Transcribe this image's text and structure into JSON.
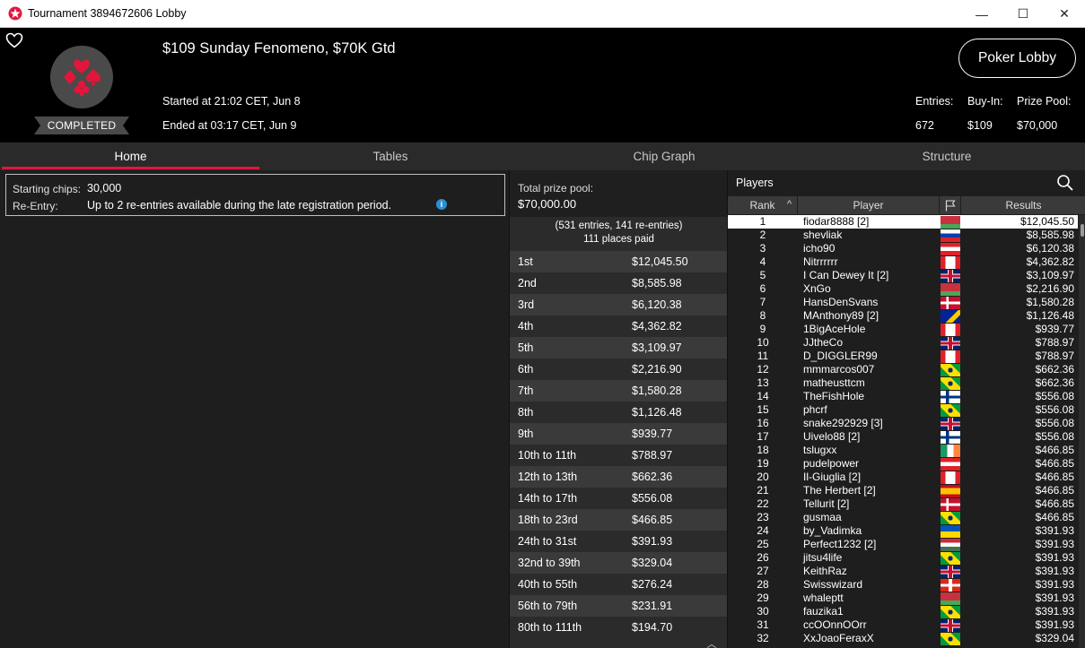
{
  "window": {
    "title": "Tournament 3894672606 Lobby",
    "minimize_glyph": "—",
    "maximize_glyph": "☐",
    "close_glyph": "✕"
  },
  "header": {
    "tournament_name": "$109 Sunday Fenomeno, $70K Gtd",
    "status": "COMPLETED",
    "started": "Started at 21:02 CET, Jun 8",
    "ended": "Ended at 03:17 CET, Jun 9",
    "poker_lobby_label": "Poker Lobby",
    "entries_label": "Entries:",
    "entries_value": "672",
    "buyin_label": "Buy-In:",
    "buyin_value": "$109",
    "prizepool_label": "Prize Pool:",
    "prizepool_value": "$70,000"
  },
  "tabs": [
    {
      "label": "Home"
    },
    {
      "label": "Tables"
    },
    {
      "label": "Chip Graph"
    },
    {
      "label": "Structure"
    }
  ],
  "home": {
    "starting_chips_label": "Starting chips:",
    "starting_chips_value": "30,000",
    "reentry_label": "Re-Entry:",
    "reentry_value": "Up to 2 re-entries available during the late registration period.",
    "info_glyph": "i"
  },
  "prizes": {
    "total_label": "Total prize pool:",
    "total_value": "$70,000.00",
    "entries_summary": "(531 entries, 141 re-entries)",
    "places_paid": "111 places paid",
    "scroll_up_glyph": "︿",
    "payouts": [
      {
        "place": "1st",
        "amount": "$12,045.50"
      },
      {
        "place": "2nd",
        "amount": "$8,585.98"
      },
      {
        "place": "3rd",
        "amount": "$6,120.38"
      },
      {
        "place": "4th",
        "amount": "$4,362.82"
      },
      {
        "place": "5th",
        "amount": "$3,109.97"
      },
      {
        "place": "6th",
        "amount": "$2,216.90"
      },
      {
        "place": "7th",
        "amount": "$1,580.28"
      },
      {
        "place": "8th",
        "amount": "$1,126.48"
      },
      {
        "place": "9th",
        "amount": "$939.77"
      },
      {
        "place": "10th to 11th",
        "amount": "$788.97"
      },
      {
        "place": "12th to 13th",
        "amount": "$662.36"
      },
      {
        "place": "14th to 17th",
        "amount": "$556.08"
      },
      {
        "place": "18th to 23rd",
        "amount": "$466.85"
      },
      {
        "place": "24th to 31st",
        "amount": "$391.93"
      },
      {
        "place": "32nd to 39th",
        "amount": "$329.04"
      },
      {
        "place": "40th to 55th",
        "amount": "$276.24"
      },
      {
        "place": "56th to 79th",
        "amount": "$231.91"
      },
      {
        "place": "80th to 111th",
        "amount": "$194.70"
      }
    ]
  },
  "players": {
    "title": "Players",
    "col_rank": "Rank",
    "col_player": "Player",
    "col_results": "Results",
    "sort_glyph": "^",
    "rows": [
      {
        "rank": "1",
        "name": "fiodar8888 [2]",
        "flag": "by",
        "result": "$12,045.50"
      },
      {
        "rank": "2",
        "name": "shevliak",
        "flag": "si",
        "result": "$8,585.98"
      },
      {
        "rank": "3",
        "name": "icho90",
        "flag": "at",
        "result": "$6,120.38"
      },
      {
        "rank": "4",
        "name": "Nitrrrrrr",
        "flag": "ca",
        "result": "$4,362.82"
      },
      {
        "rank": "5",
        "name": "I Can Dewey It [2]",
        "flag": "gb",
        "result": "$3,109.97"
      },
      {
        "rank": "6",
        "name": "XnGo",
        "flag": "by",
        "result": "$2,216.90"
      },
      {
        "rank": "7",
        "name": "HansDenSvans",
        "flag": "dk",
        "result": "$1,580.28"
      },
      {
        "rank": "8",
        "name": "MAnthony89 [2]",
        "flag": "ba",
        "result": "$1,126.48"
      },
      {
        "rank": "9",
        "name": "1BigAceHole",
        "flag": "ca",
        "result": "$939.77"
      },
      {
        "rank": "10",
        "name": "JJtheCo",
        "flag": "gb",
        "result": "$788.97"
      },
      {
        "rank": "11",
        "name": "D_DIGGLER99",
        "flag": "ca",
        "result": "$788.97"
      },
      {
        "rank": "12",
        "name": "mmmarcos007",
        "flag": "br",
        "result": "$662.36"
      },
      {
        "rank": "13",
        "name": "matheusttcm",
        "flag": "br",
        "result": "$662.36"
      },
      {
        "rank": "14",
        "name": "TheFishHole",
        "flag": "fi",
        "result": "$556.08"
      },
      {
        "rank": "15",
        "name": "phcrf",
        "flag": "br",
        "result": "$556.08"
      },
      {
        "rank": "16",
        "name": "snake292929 [3]",
        "flag": "gb",
        "result": "$556.08"
      },
      {
        "rank": "17",
        "name": "Uivelo88 [2]",
        "flag": "fi",
        "result": "$556.08"
      },
      {
        "rank": "18",
        "name": "tslugxx",
        "flag": "ie",
        "result": "$466.85"
      },
      {
        "rank": "19",
        "name": "pudelpower",
        "flag": "at",
        "result": "$466.85"
      },
      {
        "rank": "20",
        "name": "Il-Giuglia [2]",
        "flag": "ca",
        "result": "$466.85"
      },
      {
        "rank": "21",
        "name": "The Herbert [2]",
        "flag": "es",
        "result": "$466.85"
      },
      {
        "rank": "22",
        "name": "Tellurit [2]",
        "flag": "dk",
        "result": "$466.85"
      },
      {
        "rank": "23",
        "name": "gusmaa",
        "flag": "br",
        "result": "$466.85"
      },
      {
        "rank": "24",
        "name": "by_Vadimka",
        "flag": "ua",
        "result": "$391.93"
      },
      {
        "rank": "25",
        "name": "Perfect1232 [2]",
        "flag": "hu",
        "result": "$391.93"
      },
      {
        "rank": "26",
        "name": "jitsu4life",
        "flag": "br",
        "result": "$391.93"
      },
      {
        "rank": "27",
        "name": "KeithRaz",
        "flag": "gb",
        "result": "$391.93"
      },
      {
        "rank": "28",
        "name": "Swisswizard",
        "flag": "ch",
        "result": "$391.93"
      },
      {
        "rank": "29",
        "name": "whaleptt",
        "flag": "by",
        "result": "$391.93"
      },
      {
        "rank": "30",
        "name": "fauzika1",
        "flag": "br",
        "result": "$391.93"
      },
      {
        "rank": "31",
        "name": "ccOOnnOOrr",
        "flag": "gb",
        "result": "$391.93"
      },
      {
        "rank": "32",
        "name": "XxJoaoFeraxX",
        "flag": "br",
        "result": "$329.04"
      }
    ]
  },
  "colors": {
    "accent_red": "#e2163b",
    "header_bg": "#000000",
    "panel_bg": "#1e1e1e"
  }
}
